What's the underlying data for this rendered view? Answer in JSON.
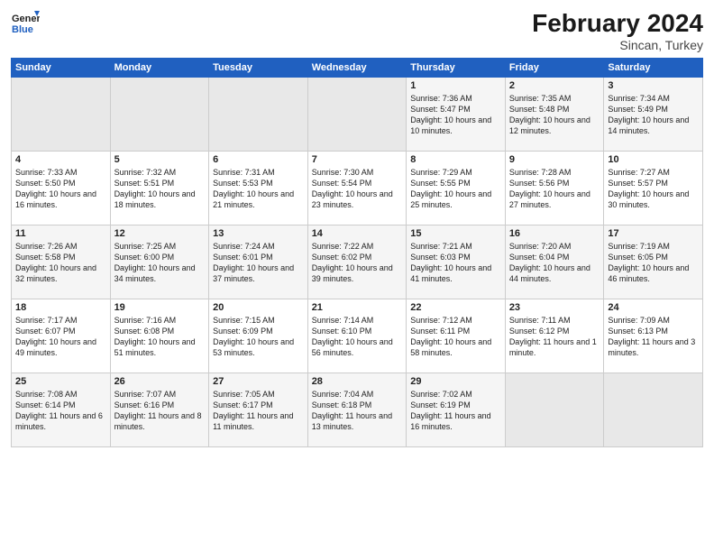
{
  "header": {
    "logo_line1": "General",
    "logo_line2": "Blue",
    "title": "February 2024",
    "subtitle": "Sincan, Turkey"
  },
  "weekdays": [
    "Sunday",
    "Monday",
    "Tuesday",
    "Wednesday",
    "Thursday",
    "Friday",
    "Saturday"
  ],
  "weeks": [
    [
      {
        "day": "",
        "empty": true
      },
      {
        "day": "",
        "empty": true
      },
      {
        "day": "",
        "empty": true
      },
      {
        "day": "",
        "empty": true
      },
      {
        "day": "1",
        "sunrise": "Sunrise: 7:36 AM",
        "sunset": "Sunset: 5:47 PM",
        "daylight": "Daylight: 10 hours and 10 minutes."
      },
      {
        "day": "2",
        "sunrise": "Sunrise: 7:35 AM",
        "sunset": "Sunset: 5:48 PM",
        "daylight": "Daylight: 10 hours and 12 minutes."
      },
      {
        "day": "3",
        "sunrise": "Sunrise: 7:34 AM",
        "sunset": "Sunset: 5:49 PM",
        "daylight": "Daylight: 10 hours and 14 minutes."
      }
    ],
    [
      {
        "day": "4",
        "sunrise": "Sunrise: 7:33 AM",
        "sunset": "Sunset: 5:50 PM",
        "daylight": "Daylight: 10 hours and 16 minutes."
      },
      {
        "day": "5",
        "sunrise": "Sunrise: 7:32 AM",
        "sunset": "Sunset: 5:51 PM",
        "daylight": "Daylight: 10 hours and 18 minutes."
      },
      {
        "day": "6",
        "sunrise": "Sunrise: 7:31 AM",
        "sunset": "Sunset: 5:53 PM",
        "daylight": "Daylight: 10 hours and 21 minutes."
      },
      {
        "day": "7",
        "sunrise": "Sunrise: 7:30 AM",
        "sunset": "Sunset: 5:54 PM",
        "daylight": "Daylight: 10 hours and 23 minutes."
      },
      {
        "day": "8",
        "sunrise": "Sunrise: 7:29 AM",
        "sunset": "Sunset: 5:55 PM",
        "daylight": "Daylight: 10 hours and 25 minutes."
      },
      {
        "day": "9",
        "sunrise": "Sunrise: 7:28 AM",
        "sunset": "Sunset: 5:56 PM",
        "daylight": "Daylight: 10 hours and 27 minutes."
      },
      {
        "day": "10",
        "sunrise": "Sunrise: 7:27 AM",
        "sunset": "Sunset: 5:57 PM",
        "daylight": "Daylight: 10 hours and 30 minutes."
      }
    ],
    [
      {
        "day": "11",
        "sunrise": "Sunrise: 7:26 AM",
        "sunset": "Sunset: 5:58 PM",
        "daylight": "Daylight: 10 hours and 32 minutes."
      },
      {
        "day": "12",
        "sunrise": "Sunrise: 7:25 AM",
        "sunset": "Sunset: 6:00 PM",
        "daylight": "Daylight: 10 hours and 34 minutes."
      },
      {
        "day": "13",
        "sunrise": "Sunrise: 7:24 AM",
        "sunset": "Sunset: 6:01 PM",
        "daylight": "Daylight: 10 hours and 37 minutes."
      },
      {
        "day": "14",
        "sunrise": "Sunrise: 7:22 AM",
        "sunset": "Sunset: 6:02 PM",
        "daylight": "Daylight: 10 hours and 39 minutes."
      },
      {
        "day": "15",
        "sunrise": "Sunrise: 7:21 AM",
        "sunset": "Sunset: 6:03 PM",
        "daylight": "Daylight: 10 hours and 41 minutes."
      },
      {
        "day": "16",
        "sunrise": "Sunrise: 7:20 AM",
        "sunset": "Sunset: 6:04 PM",
        "daylight": "Daylight: 10 hours and 44 minutes."
      },
      {
        "day": "17",
        "sunrise": "Sunrise: 7:19 AM",
        "sunset": "Sunset: 6:05 PM",
        "daylight": "Daylight: 10 hours and 46 minutes."
      }
    ],
    [
      {
        "day": "18",
        "sunrise": "Sunrise: 7:17 AM",
        "sunset": "Sunset: 6:07 PM",
        "daylight": "Daylight: 10 hours and 49 minutes."
      },
      {
        "day": "19",
        "sunrise": "Sunrise: 7:16 AM",
        "sunset": "Sunset: 6:08 PM",
        "daylight": "Daylight: 10 hours and 51 minutes."
      },
      {
        "day": "20",
        "sunrise": "Sunrise: 7:15 AM",
        "sunset": "Sunset: 6:09 PM",
        "daylight": "Daylight: 10 hours and 53 minutes."
      },
      {
        "day": "21",
        "sunrise": "Sunrise: 7:14 AM",
        "sunset": "Sunset: 6:10 PM",
        "daylight": "Daylight: 10 hours and 56 minutes."
      },
      {
        "day": "22",
        "sunrise": "Sunrise: 7:12 AM",
        "sunset": "Sunset: 6:11 PM",
        "daylight": "Daylight: 10 hours and 58 minutes."
      },
      {
        "day": "23",
        "sunrise": "Sunrise: 7:11 AM",
        "sunset": "Sunset: 6:12 PM",
        "daylight": "Daylight: 11 hours and 1 minute."
      },
      {
        "day": "24",
        "sunrise": "Sunrise: 7:09 AM",
        "sunset": "Sunset: 6:13 PM",
        "daylight": "Daylight: 11 hours and 3 minutes."
      }
    ],
    [
      {
        "day": "25",
        "sunrise": "Sunrise: 7:08 AM",
        "sunset": "Sunset: 6:14 PM",
        "daylight": "Daylight: 11 hours and 6 minutes."
      },
      {
        "day": "26",
        "sunrise": "Sunrise: 7:07 AM",
        "sunset": "Sunset: 6:16 PM",
        "daylight": "Daylight: 11 hours and 8 minutes."
      },
      {
        "day": "27",
        "sunrise": "Sunrise: 7:05 AM",
        "sunset": "Sunset: 6:17 PM",
        "daylight": "Daylight: 11 hours and 11 minutes."
      },
      {
        "day": "28",
        "sunrise": "Sunrise: 7:04 AM",
        "sunset": "Sunset: 6:18 PM",
        "daylight": "Daylight: 11 hours and 13 minutes."
      },
      {
        "day": "29",
        "sunrise": "Sunrise: 7:02 AM",
        "sunset": "Sunset: 6:19 PM",
        "daylight": "Daylight: 11 hours and 16 minutes."
      },
      {
        "day": "",
        "empty": true
      },
      {
        "day": "",
        "empty": true
      }
    ]
  ]
}
